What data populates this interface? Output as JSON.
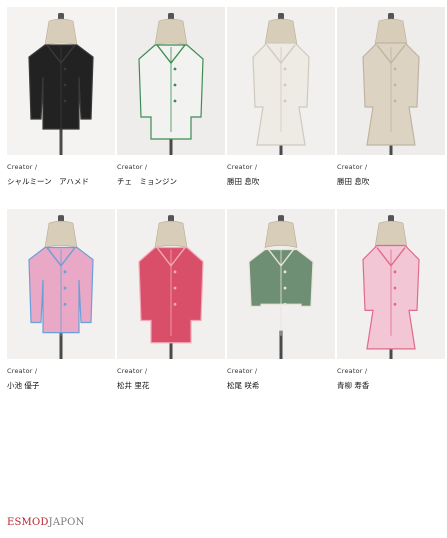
{
  "row1": [
    {
      "label": "Creator /",
      "name": "シャルミーン　アハメド",
      "bg": "#f4f3f1",
      "garment": "#222222",
      "accent": "#3a3a3a"
    },
    {
      "label": "Creator /",
      "name": "チェ　ミョンジン",
      "bg": "#eeedeb",
      "garment": "#f2f2f0",
      "accent": "#3f8c52"
    },
    {
      "label": "Creator /",
      "name": "勝田 息吹",
      "bg": "#f1f0ee",
      "garment": "#eeebe5",
      "accent": "#cfc9bd"
    },
    {
      "label": "Creator /",
      "name": "勝田 息吹",
      "bg": "#eeedeb",
      "garment": "#ddd3c3",
      "accent": "#bfb4a2"
    }
  ],
  "row2": [
    {
      "label": "Creator /",
      "name": "小池 優子",
      "bg": "#f2f1ef",
      "garment": "#e9a8c6",
      "accent": "#6b9fd8"
    },
    {
      "label": "Creator /",
      "name": "松井 里花",
      "bg": "#f1f0ee",
      "garment": "#d94f6a",
      "accent": "#f2a8b5"
    },
    {
      "label": "Creator /",
      "name": "松尾 咲希",
      "bg": "#f0efed",
      "garment": "#6f8f74",
      "accent": "#e9e4d8"
    },
    {
      "label": "Creator /",
      "name": "青柳 寿香",
      "bg": "#f1f0ee",
      "garment": "#f3c6d6",
      "accent": "#e06a8c"
    }
  ],
  "footer": {
    "brand_red": "ESMOD",
    "brand_grey": "JAPON"
  }
}
